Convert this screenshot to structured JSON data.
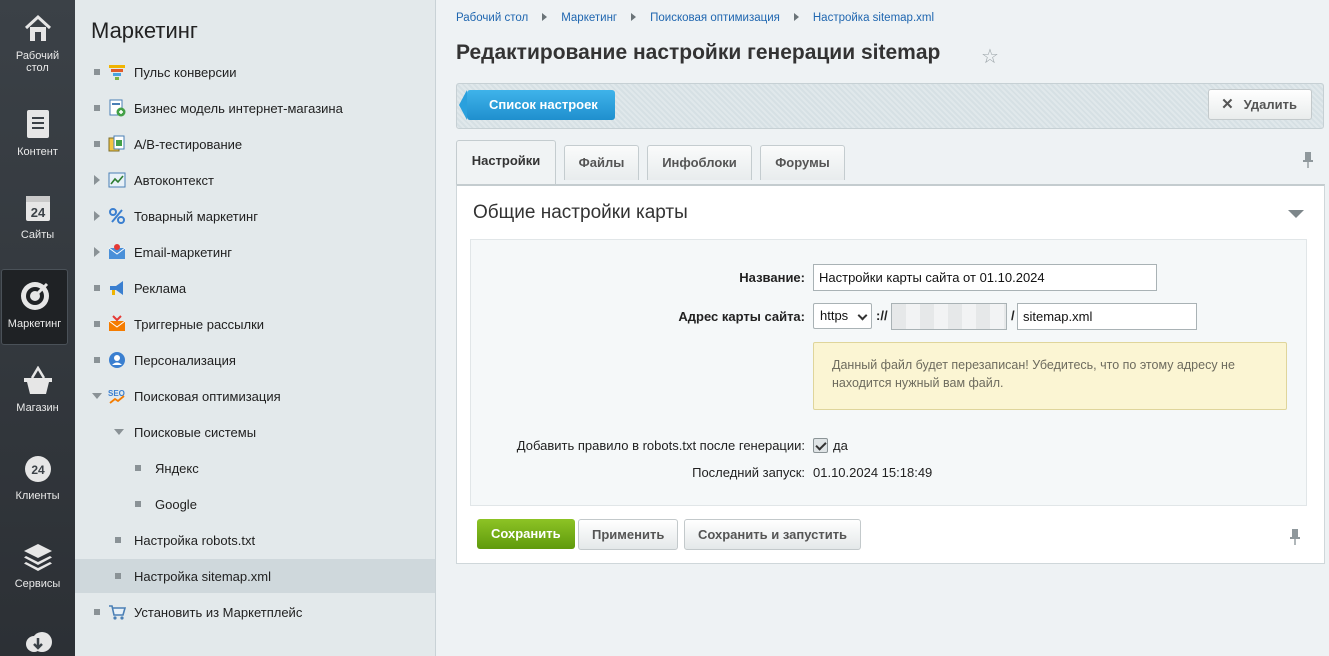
{
  "rail": {
    "items": [
      {
        "label_line1": "Рабочий",
        "label_line2": "стол"
      },
      {
        "label_line1": "Контент",
        "label_line2": ""
      },
      {
        "label_line1": "Сайты",
        "label_line2": "",
        "badge": "24"
      },
      {
        "label_line1": "Маркетинг",
        "label_line2": ""
      },
      {
        "label_line1": "Магазин",
        "label_line2": ""
      },
      {
        "label_line1": "Клиенты",
        "label_line2": "",
        "badge": "24"
      },
      {
        "label_line1": "Сервисы",
        "label_line2": ""
      }
    ]
  },
  "menu": {
    "title": "Маркетинг",
    "items": [
      {
        "label": "Пульс конверсии"
      },
      {
        "label": "Бизнес модель интернет-магазина"
      },
      {
        "label": "A/B-тестирование"
      },
      {
        "label": "Автоконтекст"
      },
      {
        "label": "Товарный маркетинг"
      },
      {
        "label": "Email-маркетинг"
      },
      {
        "label": "Реклама"
      },
      {
        "label": "Триггерные рассылки"
      },
      {
        "label": "Персонализация"
      },
      {
        "label": "Поисковая оптимизация"
      },
      {
        "label": "Поисковые системы"
      },
      {
        "label": "Яндекс"
      },
      {
        "label": "Google"
      },
      {
        "label": "Настройка robots.txt"
      },
      {
        "label": "Настройка sitemap.xml"
      },
      {
        "label": "Установить из Маркетплейс"
      }
    ],
    "seo_icon_text": "SEO"
  },
  "breadcrumbs": [
    "Рабочий стол",
    "Маркетинг",
    "Поисковая оптимизация",
    "Настройка sitemap.xml"
  ],
  "page_title": "Редактирование настройки генерации sitemap",
  "toolbar": {
    "list_label": "Список настроек",
    "delete_label": "Удалить"
  },
  "tabs": [
    "Настройки",
    "Файлы",
    "Инфоблоки",
    "Форумы"
  ],
  "panel": {
    "title": "Общие настройки карты",
    "name_label": "Название:",
    "name_value": "Настройки карты сайта от 01.10.2024",
    "address_label": "Адрес карты сайта:",
    "protocol_value": "https",
    "scheme_sep": "://",
    "path_sep": "/",
    "file_value": "sitemap.xml",
    "warning": "Данный файл будет перезаписан! Убедитесь, что по этому адресу не находится нужный вам файл.",
    "robots_label": "Добавить правило в robots.txt после генерации:",
    "robots_value": "да",
    "last_run_label": "Последний запуск:",
    "last_run_value": "01.10.2024 15:18:49"
  },
  "buttons": {
    "save": "Сохранить",
    "apply": "Применить",
    "save_run": "Сохранить и запустить"
  },
  "colors": {
    "accent_blue": "#1f8fce",
    "save_green": "#6ea512",
    "link": "#2067b0"
  }
}
